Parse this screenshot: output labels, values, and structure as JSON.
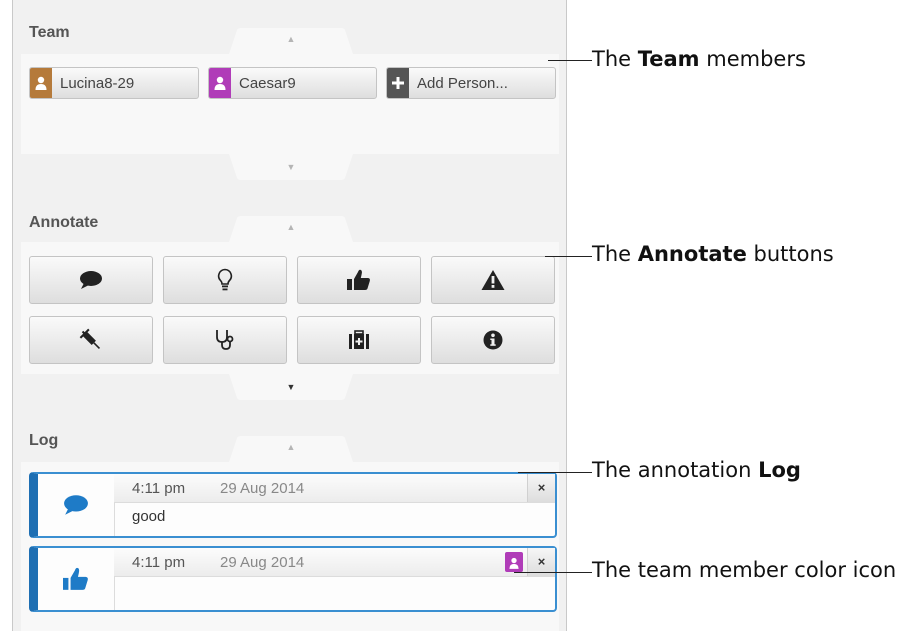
{
  "team": {
    "title": "Team",
    "members": [
      {
        "name": "Lucina8-29",
        "color": "#b57a3a"
      },
      {
        "name": "Caesar9",
        "color": "#b03cb8"
      }
    ],
    "add_label": "Add Person...",
    "add_color": "#555555"
  },
  "annotate": {
    "title": "Annotate",
    "buttons": [
      "speech-bubble-icon",
      "lightbulb-icon",
      "thumbs-up-icon",
      "warning-icon",
      "syringe-icon",
      "stethoscope-icon",
      "medical-kit-icon",
      "info-icon"
    ]
  },
  "log": {
    "title": "Log",
    "entries": [
      {
        "icon": "speech-bubble-icon",
        "time": "4:11 pm",
        "date": "29 Aug 2014",
        "text": "good",
        "close": "×"
      },
      {
        "icon": "thumbs-up-icon",
        "time": "4:11 pm",
        "date": "29 Aug 2014",
        "text": "",
        "member_color": "#b03cb8",
        "close": "×"
      }
    ]
  },
  "callouts": [
    {
      "pre": "The ",
      "bold": "Team",
      "post": " members"
    },
    {
      "pre": "The ",
      "bold": "Annotate",
      "post": " buttons"
    },
    {
      "pre": "The annotation ",
      "bold": "Log",
      "post": ""
    },
    {
      "pre": "The team member color icon",
      "bold": "",
      "post": ""
    }
  ],
  "accent_color": "#1e6fb3"
}
